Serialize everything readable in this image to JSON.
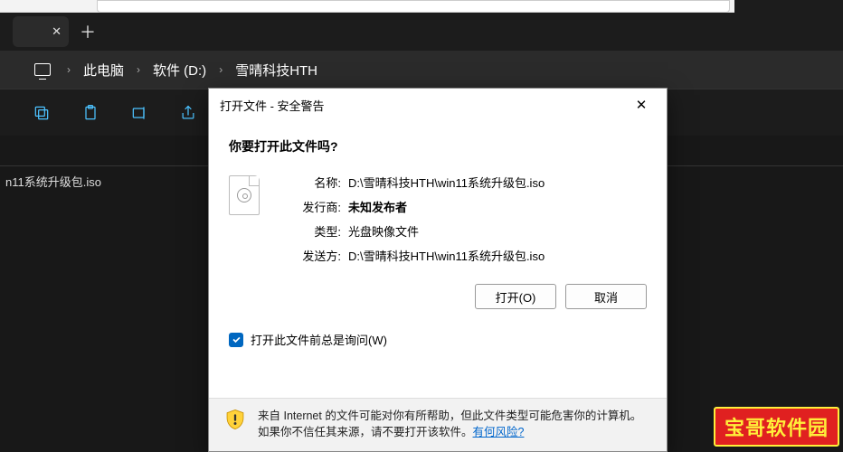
{
  "breadcrumb": [
    "此电脑",
    "软件 (D:)",
    "雪晴科技HTH"
  ],
  "file_list": [
    "n11系统升级包.iso"
  ],
  "dialog": {
    "title": "打开文件 - 安全警告",
    "question": "你要打开此文件吗?",
    "fields": {
      "name": {
        "label": "名称:",
        "value": "D:\\雪晴科技HTH\\win11系统升级包.iso"
      },
      "publisher": {
        "label": "发行商:",
        "value": "未知发布者"
      },
      "type": {
        "label": "类型:",
        "value": "光盘映像文件"
      },
      "source": {
        "label": "发送方:",
        "value": "D:\\雪晴科技HTH\\win11系统升级包.iso"
      }
    },
    "buttons": {
      "open": "打开(O)",
      "cancel": "取消"
    },
    "checkbox": "打开此文件前总是询问(W)",
    "footer": {
      "text": "来自 Internet 的文件可能对你有所帮助，但此文件类型可能危害你的计算机。如果你不信任其来源，请不要打开该软件。",
      "link": "有何风险?"
    }
  },
  "watermark": "宝哥软件园"
}
